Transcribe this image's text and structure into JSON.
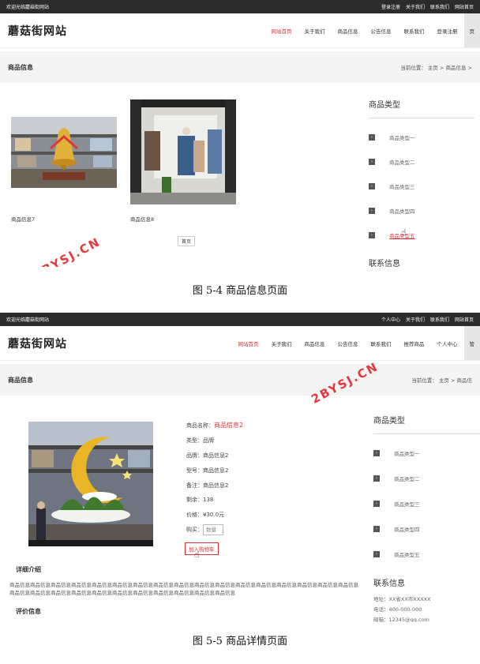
{
  "shot1": {
    "topbar": {
      "welcome": "欢迎光临蘑菇街网站",
      "links": [
        "登录注册",
        "关于我们",
        "联系我们",
        "网站首页"
      ]
    },
    "brand": "蘑菇街网站",
    "nav": [
      "网站首页",
      "关于我们",
      "商品信息",
      "公告信息",
      "联系我们",
      "登录注册",
      "页"
    ],
    "page_title": "商品信息",
    "location": "当前位置：  主页 > 商品信息 >",
    "products": [
      {
        "name": "商品信息7"
      },
      {
        "name": "商品信息8"
      }
    ],
    "page_button": "首页",
    "sidebar": {
      "title": "商品类型",
      "categories": [
        "商品类型一",
        "商品类型二",
        "商品类型三",
        "商品类型四",
        "商品类型五"
      ],
      "contact_title": "联系信息"
    }
  },
  "caption1": "图 5-4 商品信息页面",
  "shot2": {
    "topbar": {
      "welcome": "欢迎光临蘑菇街网站",
      "links": [
        "个人中心",
        "关于我们",
        "联系我们",
        "网站首页"
      ]
    },
    "brand": "蘑菇街网站",
    "nav": [
      "网站首页",
      "关于我们",
      "商品信息",
      "公告信息",
      "联系我们",
      "推荐商品",
      "个人中心",
      "管"
    ],
    "page_title": "商品信息",
    "location": "当前位置：  主页 > 商品信",
    "detail": {
      "name_label": "商品名称：",
      "name_value": "商品信息2",
      "rows": [
        "类型：品牌",
        "品牌：商品信息2",
        "型号：商品信息2",
        "备注：商品信息2",
        "剩余：138",
        "价格：¥30.0元"
      ],
      "buy_label": "购买：",
      "qty_placeholder": "数量",
      "cart_button": "加入购物车"
    },
    "intro_title": "详细介绍",
    "intro_text": "商品信息商品信息商品信息商品信息商品信息商品信息商品信息商品信息商品信息商品信息商品信息商品信息商品信息商品信息商品信息商品信息商品信息商品信息商品信息商品信息商品信息商品信息商品信息商品信息商品信息商品信息商品信息商品信息",
    "review_title": "评价信息",
    "sidebar": {
      "title": "商品类型",
      "categories": [
        "商品类型一",
        "商品类型二",
        "商品类型三",
        "商品类型四",
        "商品类型五"
      ],
      "contact_title": "联系信息",
      "contact_lines": [
        "地址：XX省XX市XXXXX",
        "电话：400-000-000",
        "邮箱：12345@qq.com"
      ]
    }
  },
  "caption2": "图 5-5 商品详情页面",
  "watermark": "2BYSJ.CN",
  "colors": {
    "accent": "#d9333f",
    "topbar": "#2b2b2b",
    "crumb_bg": "#f4f4f4"
  }
}
